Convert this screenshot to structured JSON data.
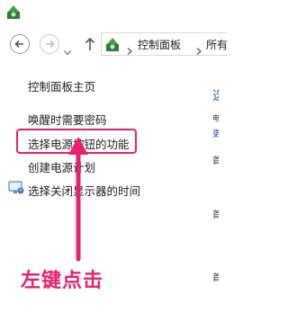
{
  "window": {
    "icon": "control-panel-icon"
  },
  "nav": {
    "back_icon": "back-arrow-icon",
    "forward_icon": "forward-arrow-icon",
    "dropdown_icon": "chevron-down-icon",
    "up_icon": "up-arrow-icon"
  },
  "address": {
    "icon": "control-panel-icon",
    "crumbs": [
      "控制面板",
      "所有"
    ]
  },
  "sidebar": {
    "items": [
      {
        "label": "控制面板主页"
      },
      {
        "label": "唤醒时需要密码"
      },
      {
        "label": "选择电源按钮的功能"
      },
      {
        "label": "创建电源计划"
      },
      {
        "label": "选择关闭显示器的时间",
        "icon": "display-power-icon"
      }
    ]
  },
  "main_edge": {
    "fragments": [
      "选",
      "电",
      "更",
      "首",
      "首",
      "首"
    ]
  },
  "annotation": {
    "text": "左键点击",
    "color": "#e8206f"
  }
}
